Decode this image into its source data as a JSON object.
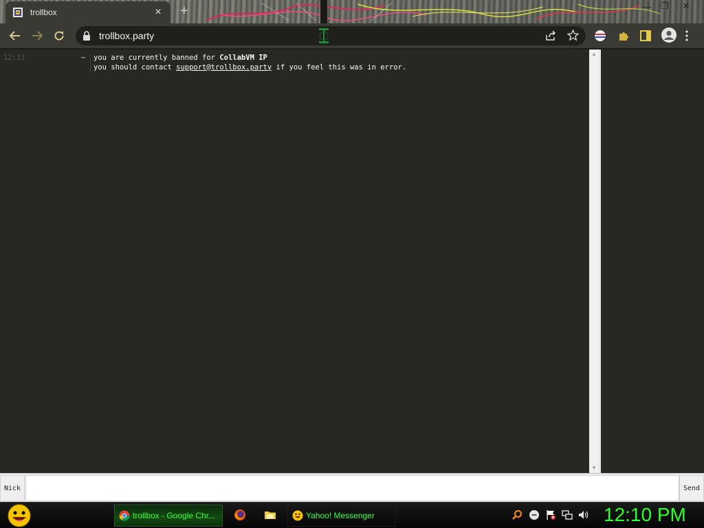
{
  "browser": {
    "tab_title": "trollbox",
    "tab_close": "×",
    "new_tab": "+",
    "url": "trollbox.party",
    "window_controls": {
      "minimize": "—",
      "restore": "❐",
      "close": "✕"
    }
  },
  "chat": {
    "messages": [
      {
        "time": "12:11",
        "nick": "~",
        "line1_pre": "you are currently banned for ",
        "line1_bold": "CollabVM IP",
        "line2_pre": "you should contact ",
        "line2_link": "support@trollbox.party",
        "line2_post": " if you feel this was in error."
      }
    ]
  },
  "input": {
    "nick_label": "Nick",
    "message_value": "",
    "send_label": "Send"
  },
  "taskbar": {
    "items": [
      {
        "label": "trollbox - Google Chr...",
        "icon": "chrome-icon",
        "active": true
      },
      {
        "label": "Yahoo! Messenger",
        "icon": "yahoo-messenger-icon",
        "active": false
      }
    ],
    "quick_launch": [
      "firefox-icon",
      "folder-icon"
    ],
    "tray_icons": [
      "search-icon",
      "messenger-status-icon",
      "flag-icon",
      "network-icon",
      "volume-icon"
    ],
    "clock": "12:10 PM"
  },
  "colors": {
    "page_bg": "#272822",
    "chat_text": "#f8f8f2",
    "taskbar_text": "#3cff3c",
    "clock": "#2bff2b"
  }
}
